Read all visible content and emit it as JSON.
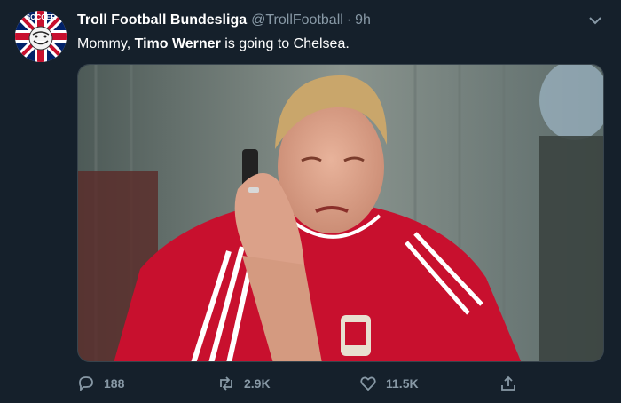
{
  "tweet": {
    "display_name": "Troll Football Bundesliga",
    "handle": "@TrollFootball",
    "separator": "·",
    "time": "9h",
    "text_before": "Mommy, ",
    "text_bold": "Timo Werner",
    "text_after": " is going to Chelsea.",
    "avatar_icon": "soccer-troll-union-jack-badge",
    "avatar_text_top": "SOCCER",
    "media_icon": "crying-fan-on-phone-photo"
  },
  "actions": {
    "reply_count": "188",
    "retweet_count": "2.9K",
    "like_count": "11.5K"
  },
  "colors": {
    "background": "#15202b",
    "secondary_text": "#8899a6",
    "shirt_red": "#c8102e"
  }
}
